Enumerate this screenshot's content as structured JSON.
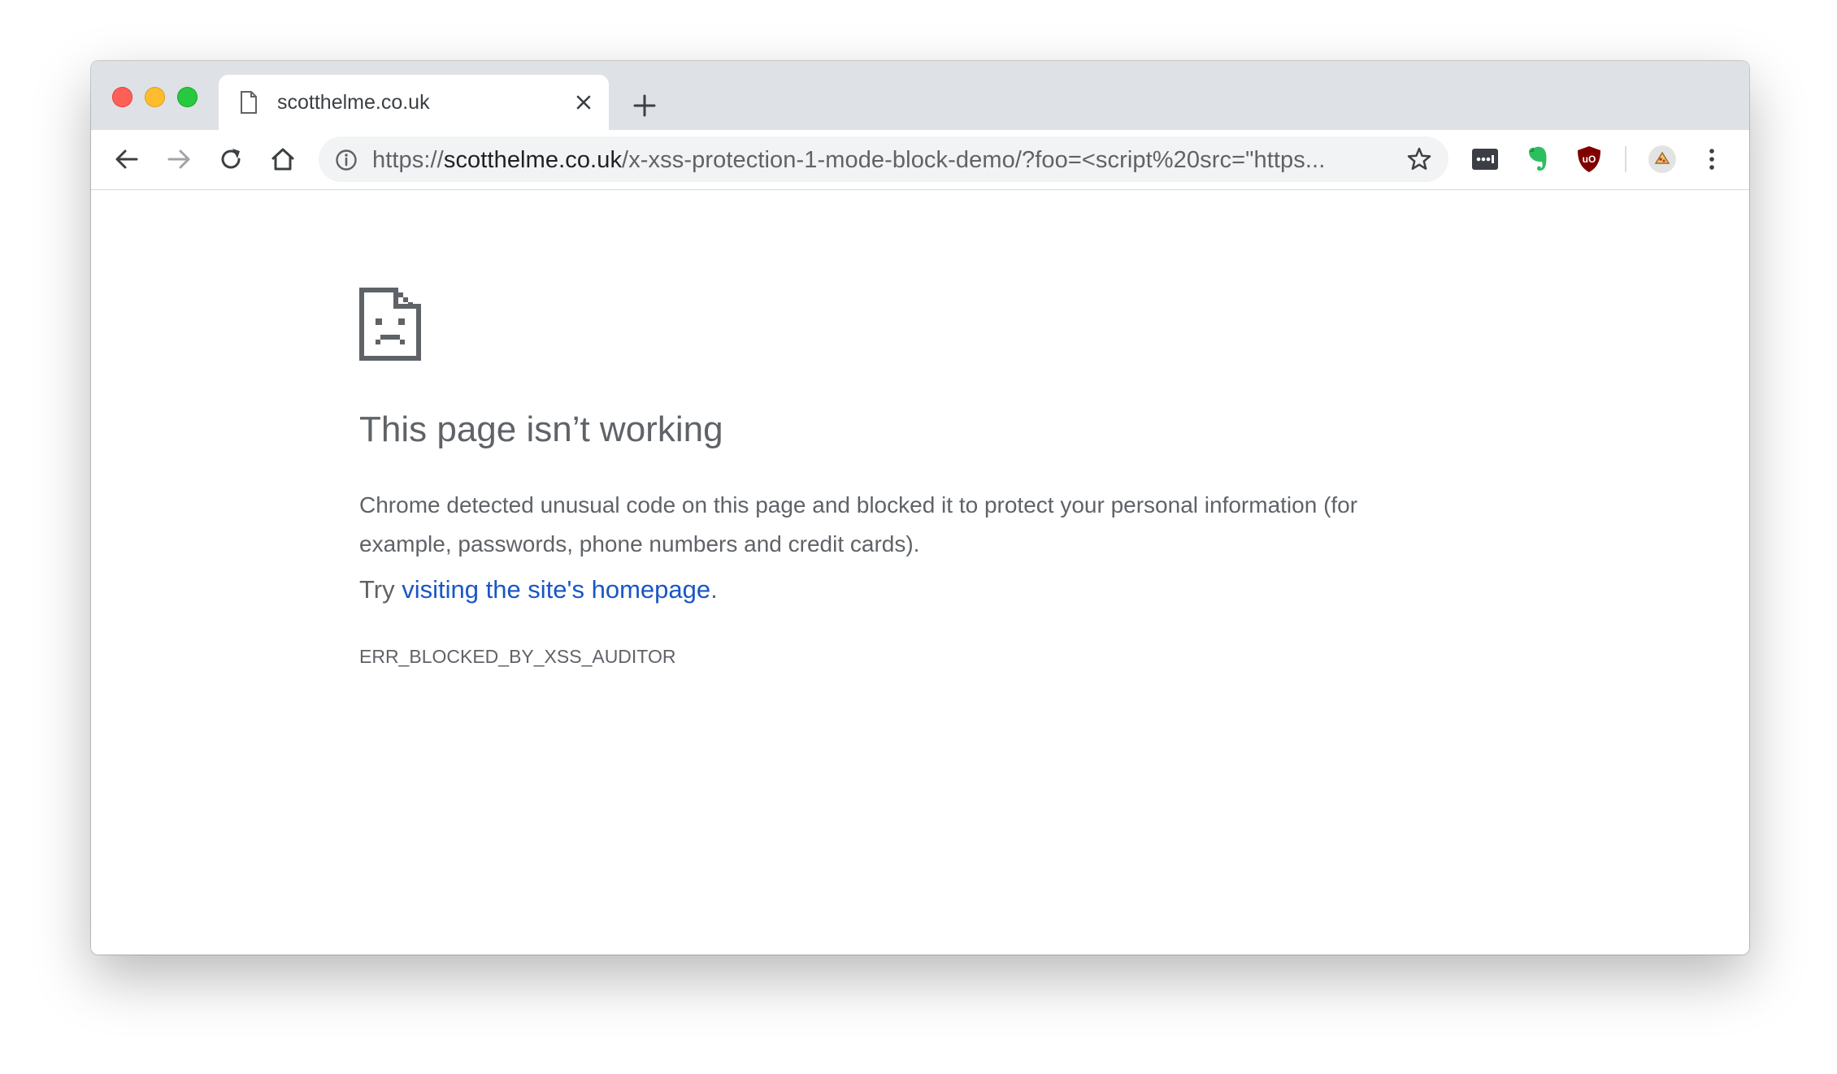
{
  "tab": {
    "title": "scotthelme.co.uk"
  },
  "omnibox": {
    "url_scheme": "https://",
    "url_host": "scotthelme.co.uk",
    "url_path": "/x-xss-protection-1-mode-block-demo/?foo=<script%20src=\"https..."
  },
  "error": {
    "title": "This page isn’t working",
    "description": "Chrome detected unusual code on this page and blocked it to protect your personal information (for example, passwords, phone numbers and credit cards).",
    "try_prefix": "Try ",
    "try_link": "visiting the site's homepage",
    "try_suffix": ".",
    "code": "ERR_BLOCKED_BY_XSS_AUDITOR"
  },
  "icons": {
    "tab_favicon": "page-icon",
    "tab_close": "close-icon",
    "new_tab": "plus-icon",
    "back": "arrow-left-icon",
    "forward": "arrow-right-icon",
    "reload": "reload-icon",
    "home": "home-icon",
    "site_info": "info-icon",
    "bookmark": "star-icon",
    "ext1": "password-manager-icon",
    "ext2": "evernote-icon",
    "ext3": "ublock-icon",
    "profile": "avatar-icon",
    "menu": "more-vert-icon",
    "sad_page": "sad-page-icon"
  },
  "colors": {
    "link": "#1a56c5",
    "text": "#5f6368",
    "titlebar": "#dee1e6",
    "omnibox": "#f1f3f4"
  }
}
